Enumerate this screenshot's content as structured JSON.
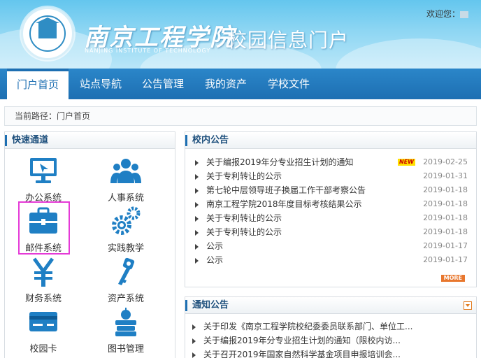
{
  "header": {
    "school_name": "南京工程学院",
    "school_name_en": "NANJING INSTITUTE OF TECHNOLOGY",
    "portal_title": "校园信息门户",
    "welcome": "欢迎您："
  },
  "nav": {
    "items": [
      "门户首页",
      "站点导航",
      "公告管理",
      "我的资产",
      "学校文件"
    ],
    "active": "门户首页"
  },
  "breadcrumb": {
    "label": "当前路径：",
    "current": "门户首页"
  },
  "quick": {
    "title": "快速通道",
    "items": [
      {
        "label": "办公系统",
        "icon": "monitor-icon"
      },
      {
        "label": "人事系统",
        "icon": "people-icon"
      },
      {
        "label": "邮件系统",
        "icon": "briefcase-icon"
      },
      {
        "label": "实践教学",
        "icon": "gears-icon"
      },
      {
        "label": "财务系统",
        "icon": "yen-icon"
      },
      {
        "label": "资产系统",
        "icon": "key-icon"
      },
      {
        "label": "校园卡",
        "icon": "card-icon"
      },
      {
        "label": "图书管理",
        "icon": "books-icon"
      }
    ],
    "selected": "邮件系统"
  },
  "campus_notices": {
    "title": "校内公告",
    "items": [
      {
        "title": "关于编报2019年分专业招生计划的通知",
        "date": "2019-02-25",
        "new": true
      },
      {
        "title": "关于专利转让的公示",
        "date": "2019-01-31"
      },
      {
        "title": "第七轮中层领导班子换届工作干部考察公告",
        "date": "2019-01-18"
      },
      {
        "title": "南京工程学院2018年度目标考核结果公示",
        "date": "2019-01-18"
      },
      {
        "title": "关于专利转让的公示",
        "date": "2019-01-18"
      },
      {
        "title": "关于专利转让的公示",
        "date": "2019-01-18"
      },
      {
        "title": "公示",
        "date": "2019-01-17"
      },
      {
        "title": "公示",
        "date": "2019-01-17"
      }
    ],
    "new_badge": "NEW",
    "more_label": "MORE"
  },
  "notifications": {
    "title": "通知公告",
    "items": [
      {
        "title": "关于印发《南京工程学院校纪委委员联系部门、单位工..."
      },
      {
        "title": "关于编报2019年分专业招生计划的通知（限校内访..."
      },
      {
        "title": "关于召开2019年国家自然科学基金项目申报培训会..."
      }
    ]
  },
  "colors": {
    "header_sky": "#64c6ee",
    "nav_blue": "#1d6fb2",
    "icon_blue": "#1f7fc4",
    "highlight": "#e53ad7",
    "more_orange": "#e8772e"
  }
}
